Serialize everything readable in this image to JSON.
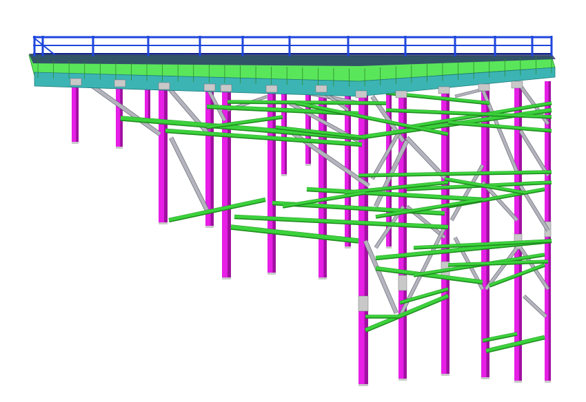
{
  "view": {
    "background": "#ffffff",
    "description_free": true
  },
  "palette": {
    "column": "#e61ee6",
    "column_shade": "#a010a0",
    "beam": "#3cd23c",
    "beam_shade": "#1e8c1e",
    "deck_top": "#5ae65a",
    "deck_side": "#3cb4b4",
    "brace": "#b4b4be",
    "brace_shade": "#6e6e78",
    "railing": "#1e46dc",
    "railing_dark": "#0a1e8c",
    "plate": "#c8c8c8"
  }
}
